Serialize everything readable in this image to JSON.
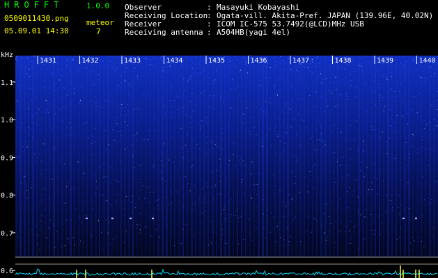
{
  "header": {
    "app_title": "HROFFT",
    "app_version": "1.0.0",
    "file_name": "0509011430.png",
    "date_time": "05.09.01 14:30",
    "meteor_label": "meteor",
    "meteor_count": "7"
  },
  "info": [
    {
      "label": "Observer",
      "sep": ":",
      "value": "Masayuki Kobayashi"
    },
    {
      "label": "Receiving Location",
      "sep": ":",
      "value": "Ogata-vill. Akita-Pref. JAPAN (139.96E, 40.02N)"
    },
    {
      "label": "Receiver",
      "sep": ":",
      "value": "ICOM IC-575 53.7492(@LCD)MHz USB"
    },
    {
      "label": "Receiving antenna",
      "sep": ":",
      "value": "A504HB(yagi 4el)"
    }
  ],
  "colors": {
    "green_text": "#00ff00",
    "yellow_text": "#ffff00",
    "spectrum_blue": "#2244ff",
    "trace_cyan": "#00e0ff"
  },
  "spectrogram": {
    "y_unit": "kHz",
    "y_ticks": [
      {
        "label": "1.1",
        "value": 1.1
      },
      {
        "label": "1.0",
        "value": 1.0
      },
      {
        "label": "0.9",
        "value": 0.9
      },
      {
        "label": "0.8",
        "value": 0.8
      },
      {
        "label": "0.7",
        "value": 0.7
      },
      {
        "label": "0.6",
        "value": 0.6
      }
    ],
    "y_range": [
      0.58,
      1.17
    ],
    "time_ticks": [
      "1431",
      "1432",
      "1433",
      "1434",
      "1435",
      "1436",
      "1437",
      "1438",
      "1439",
      "1440"
    ]
  }
}
